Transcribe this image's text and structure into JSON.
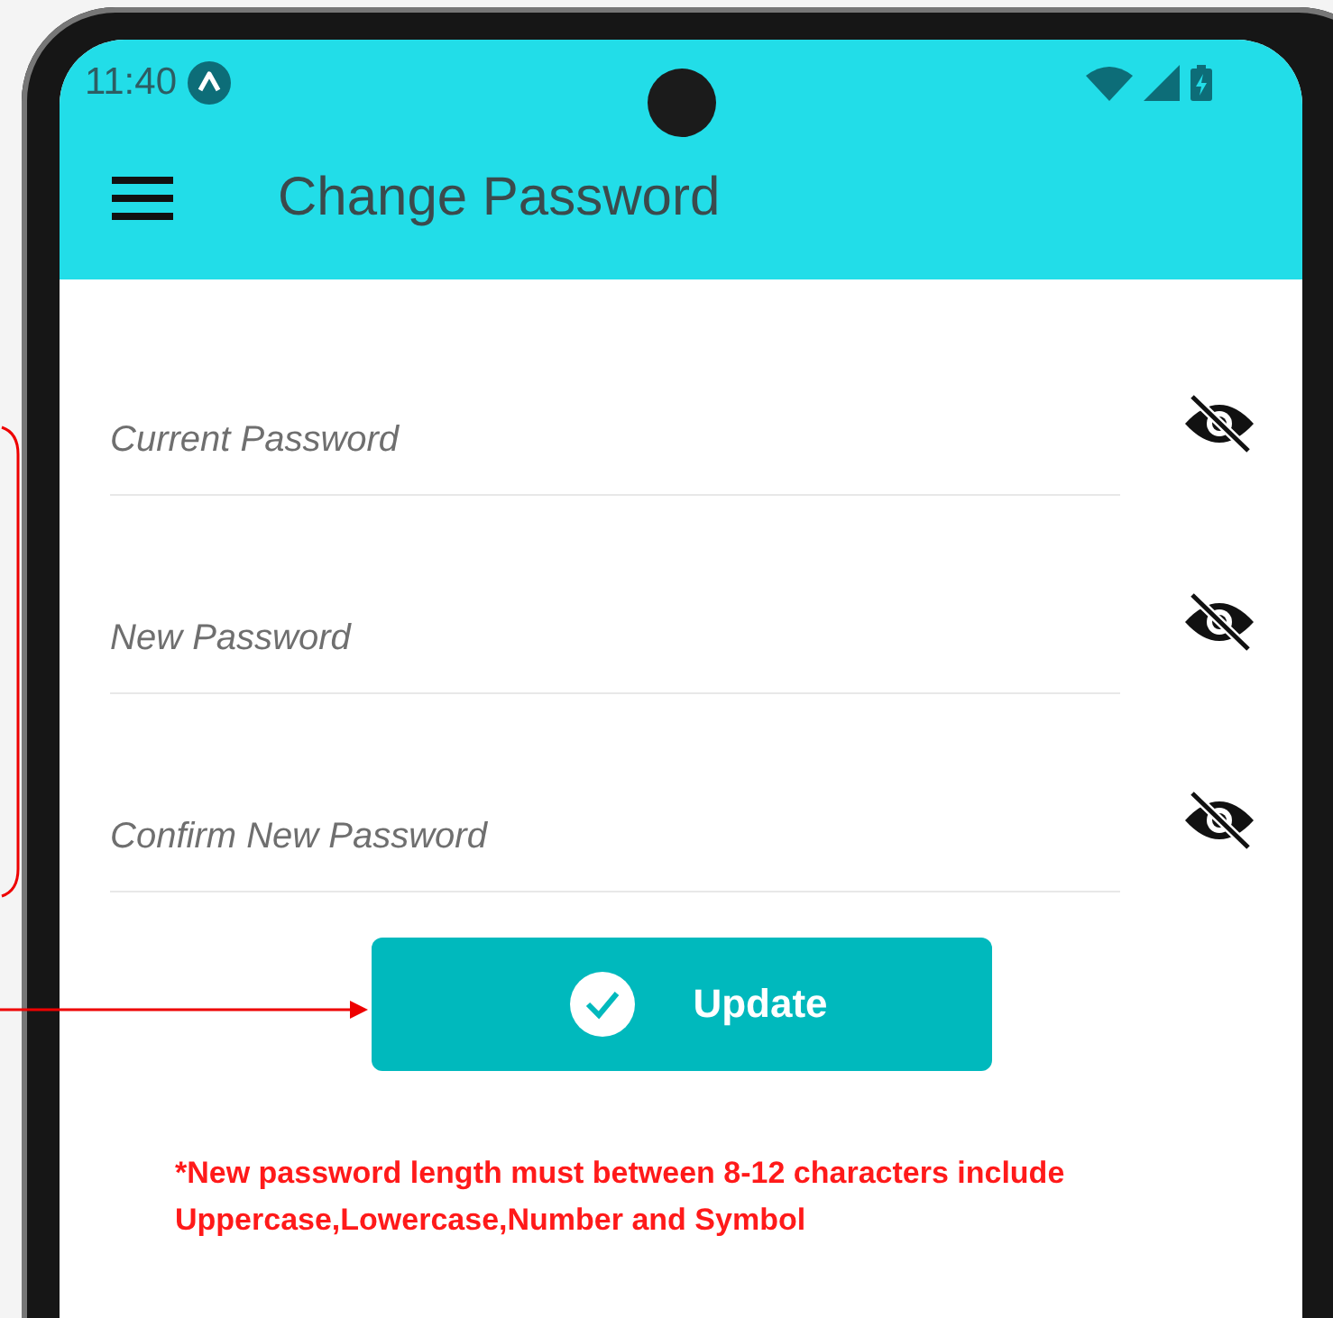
{
  "status_bar": {
    "time": "11:40"
  },
  "app_bar": {
    "title": "Change Password"
  },
  "fields": [
    {
      "placeholder": "Current Password",
      "password_visible": false
    },
    {
      "placeholder": "New Password",
      "password_visible": false
    },
    {
      "placeholder": "Confirm New Password",
      "password_visible": false
    }
  ],
  "update_button": {
    "label": "Update"
  },
  "note": "*New password length must between 8-12 characters include Uppercase,Lowercase,Number and Symbol"
}
